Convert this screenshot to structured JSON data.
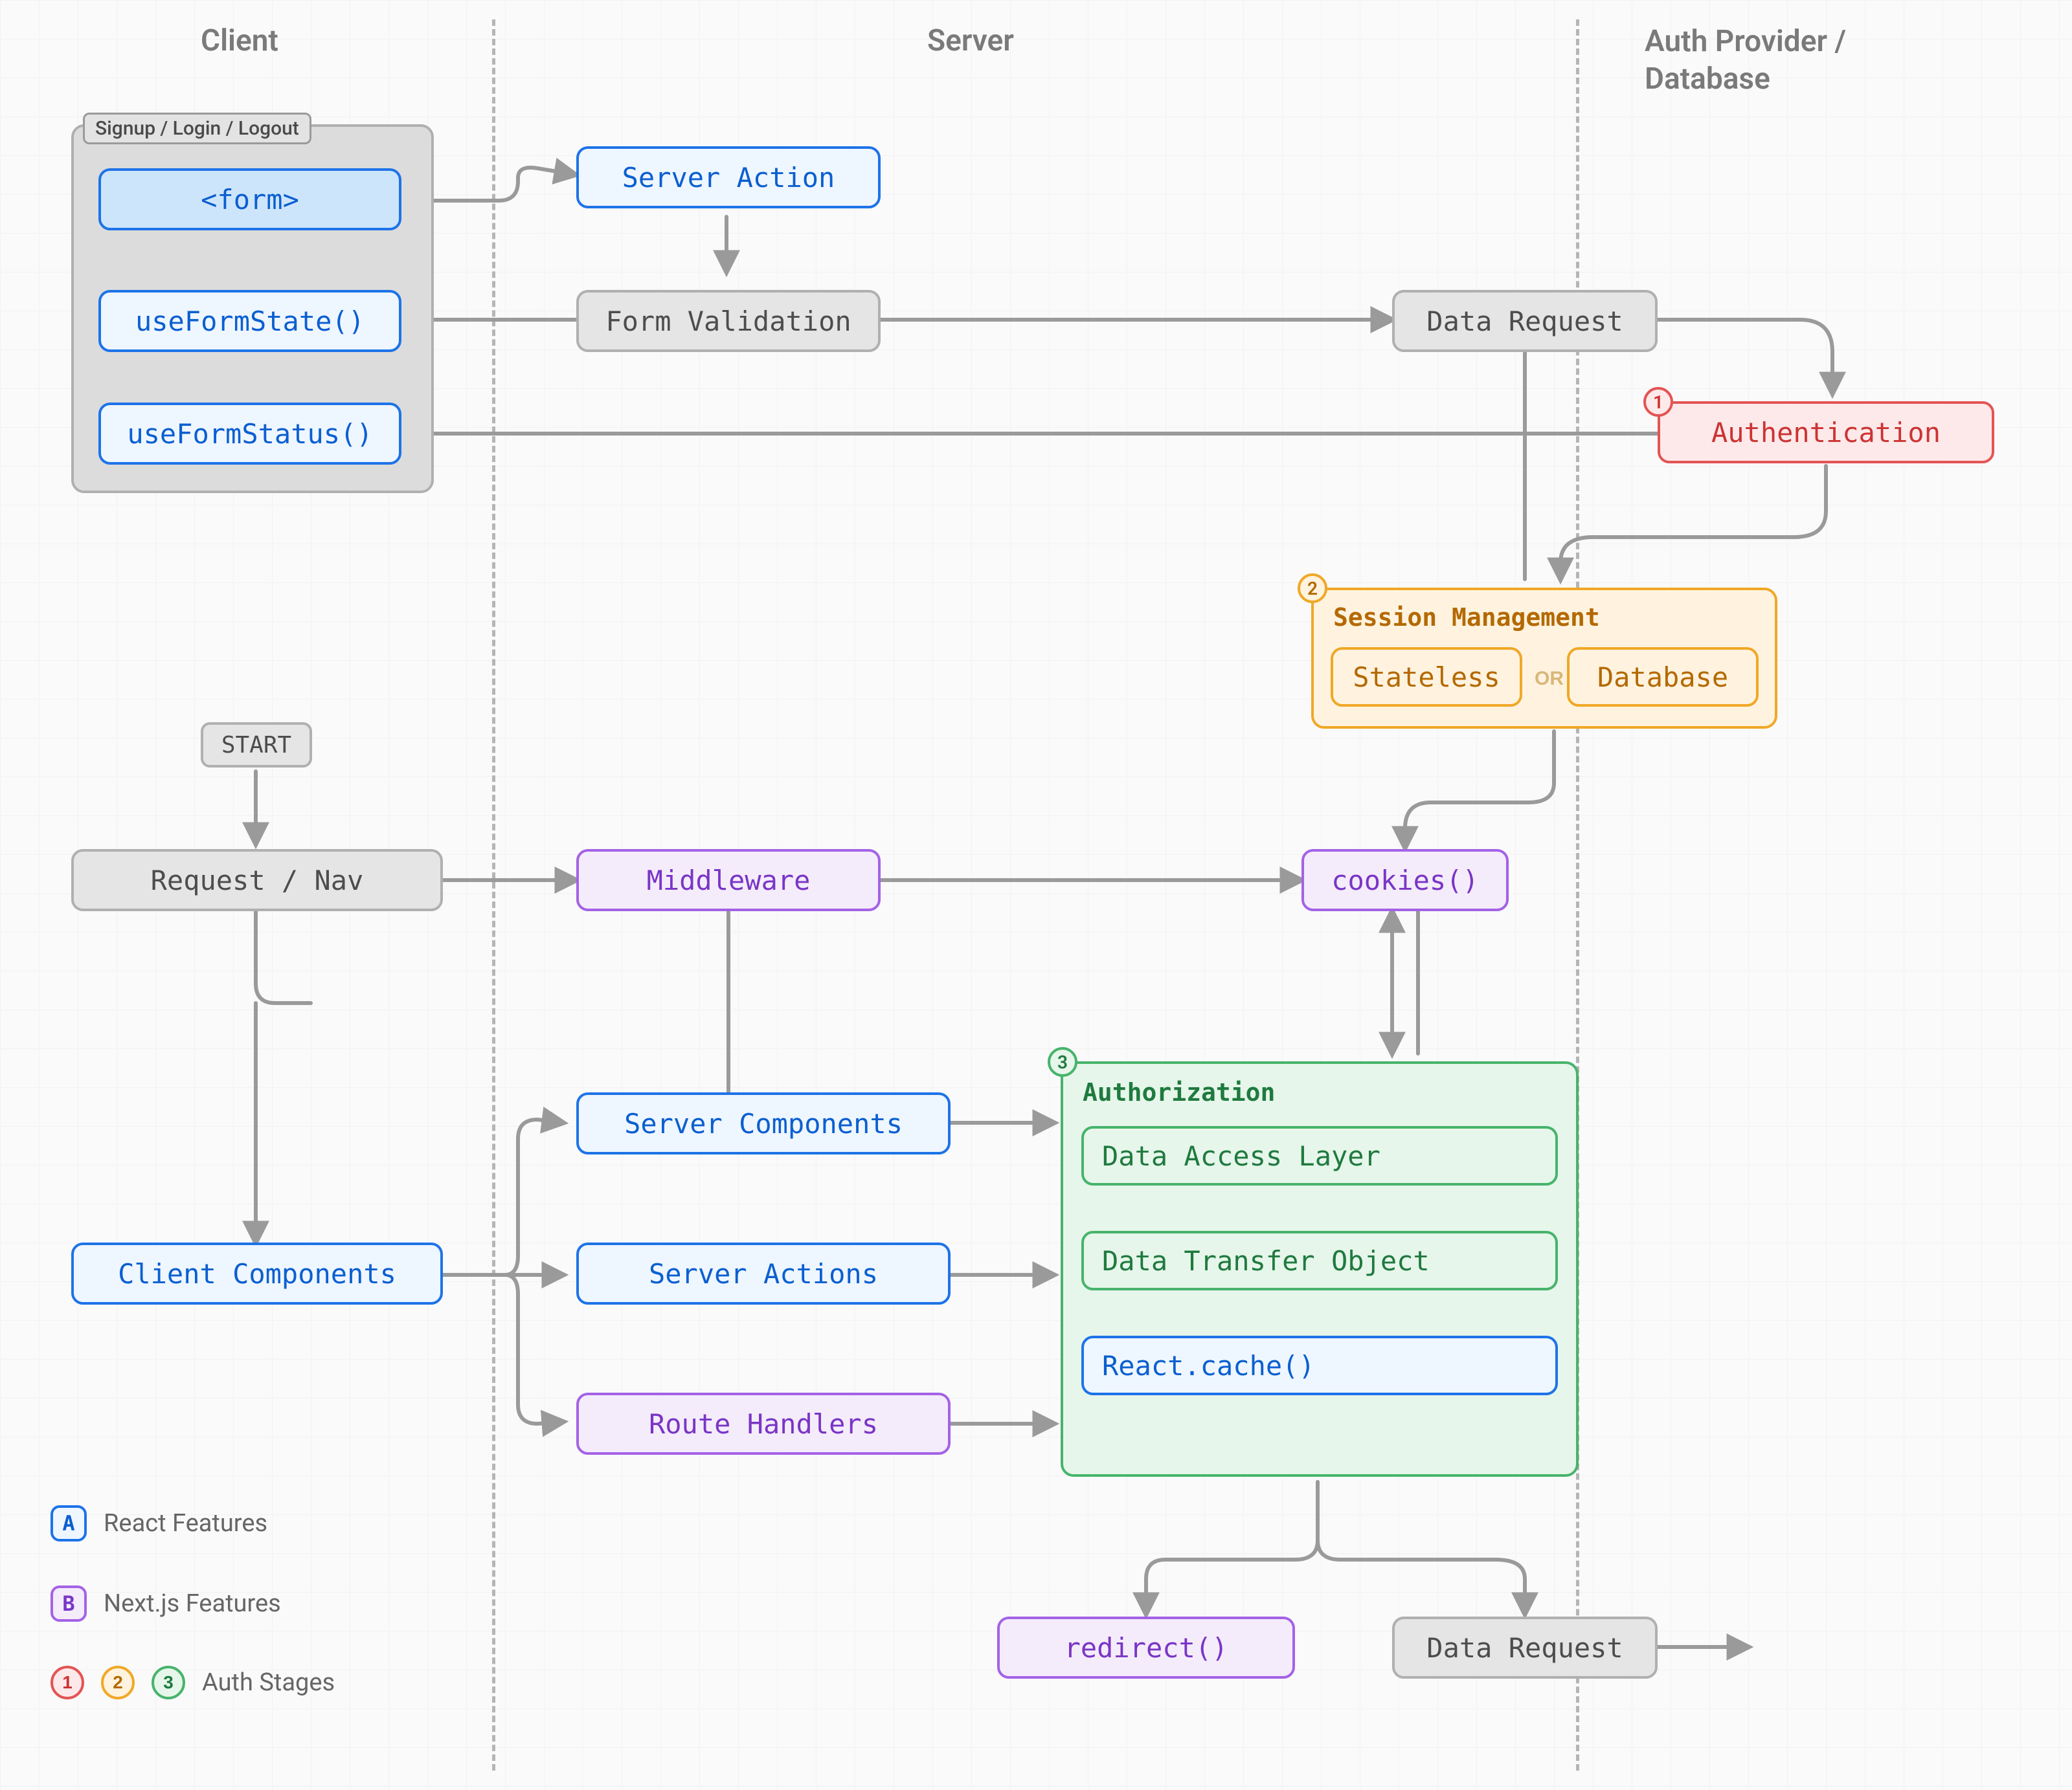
{
  "lanes": {
    "client": "Client",
    "server": "Server",
    "provider": "Auth Provider / Database"
  },
  "client": {
    "panel_label": "Signup / Login / Logout",
    "form": "<form>",
    "useFormState": "useFormState()",
    "useFormStatus": "useFormStatus()",
    "start": "START",
    "request_nav": "Request / Nav",
    "client_components": "Client Components"
  },
  "server": {
    "server_action": "Server Action",
    "form_validation": "Form Validation",
    "middleware": "Middleware",
    "server_components": "Server Components",
    "server_actions": "Server Actions",
    "route_handlers": "Route Handlers",
    "redirect": "redirect()"
  },
  "provider": {
    "data_request_top": "Data Request",
    "authentication": "Authentication",
    "session_mgmt": "Session Management",
    "stateless": "Stateless",
    "database": "Database",
    "or": "OR",
    "cookies": "cookies()",
    "authorization": "Authorization",
    "dal": "Data Access Layer",
    "dto": "Data Transfer Object",
    "react_cache": "React.cache()",
    "data_request_bottom": "Data Request"
  },
  "badges": {
    "one": "1",
    "two": "2",
    "three": "3"
  },
  "legend": {
    "react": {
      "letter": "A",
      "label": "React Features"
    },
    "next": {
      "letter": "B",
      "label": "Next.js Features"
    },
    "stages_label": "Auth Stages"
  },
  "colors": {
    "blue": "#1e73e8",
    "purple": "#a462e6",
    "red": "#e35454",
    "orange": "#f0a827",
    "green": "#47b46c",
    "gray": "#b0b0b0"
  }
}
